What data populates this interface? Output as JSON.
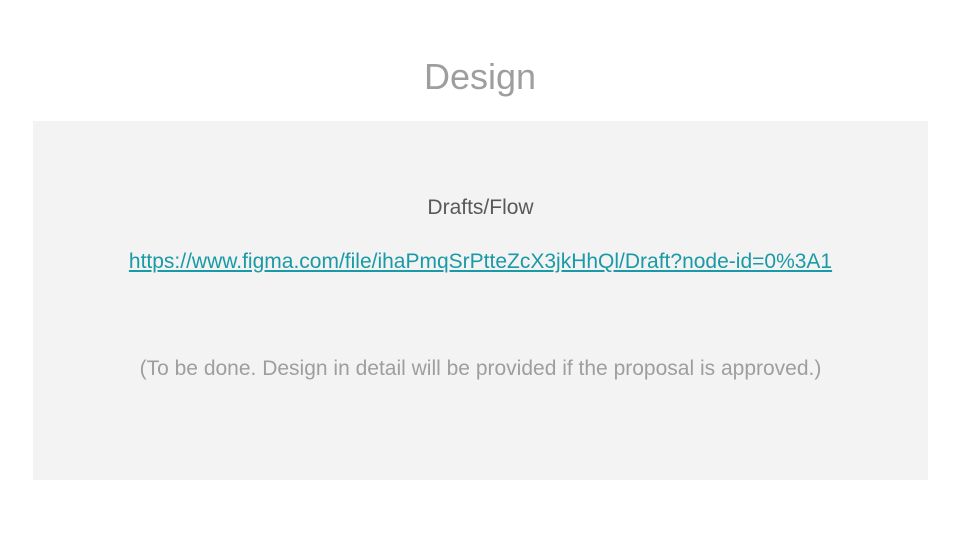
{
  "slide": {
    "title": "Design",
    "content": {
      "subheading": "Drafts/Flow",
      "link_text": "https://www.figma.com/file/ihaPmqSrPtteZcX3jkHhQl/Draft?node-id=0%3A1",
      "link_href": "https://www.figma.com/file/ihaPmqSrPtteZcX3jkHhQl/Draft?node-id=0%3A1",
      "note": "(To be done. Design in detail will be provided if the proposal is approved.)"
    }
  },
  "colors": {
    "title": "#9e9e9e",
    "panel_background": "#f3f3f3",
    "subheading": "#595959",
    "link": "#1a9aa6",
    "note": "#9e9e9e"
  }
}
